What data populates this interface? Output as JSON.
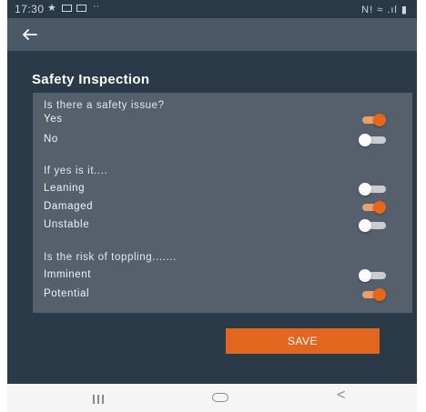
{
  "status_bar": {
    "time": "17:30",
    "icons": [
      "download-icon",
      "image-icon",
      "image-icon",
      "more-dots-icon",
      "signal-icon",
      "wifi-icon",
      "battery-icon"
    ],
    "right_text": "N! ≈ .ıl ▮"
  },
  "app_bar": {
    "back_icon": "arrow-left-icon"
  },
  "page": {
    "title": "Safety Inspection"
  },
  "form": {
    "q1": {
      "question": "Is there a safety issue?",
      "options": [
        {
          "label": "Yes",
          "on": true
        },
        {
          "label": "No",
          "on": false
        }
      ]
    },
    "q2": {
      "question": "If yes is it....",
      "options": [
        {
          "label": "Leaning",
          "on": false
        },
        {
          "label": "Damaged",
          "on": true
        },
        {
          "label": "Unstable",
          "on": false
        }
      ]
    },
    "q3": {
      "question": "Is the risk of toppling.......",
      "options": [
        {
          "label": "Imminent",
          "on": false
        },
        {
          "label": "Potential",
          "on": true
        }
      ]
    }
  },
  "save_button": {
    "label": "SAVE"
  },
  "nav_bar": {
    "items": [
      "recent-apps-icon",
      "home-icon",
      "back-icon"
    ]
  },
  "colors": {
    "accent": "#e8661b",
    "background": "#2b3a48",
    "card": "#55606c",
    "app_bar": "#4b5866"
  }
}
